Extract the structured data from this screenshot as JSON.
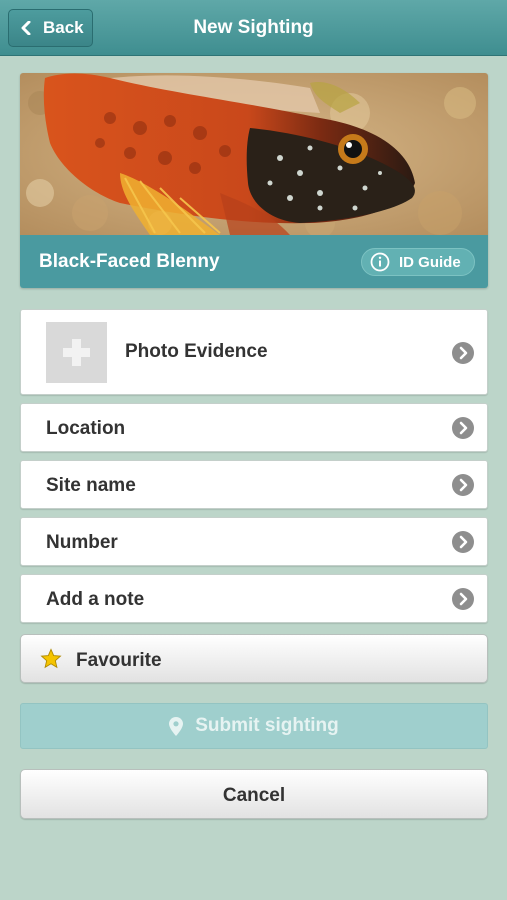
{
  "header": {
    "back_label": "Back",
    "title": "New Sighting"
  },
  "species": {
    "name": "Black-Faced Blenny",
    "id_guide_label": "ID Guide"
  },
  "rows": {
    "photo_evidence": "Photo Evidence",
    "location": "Location",
    "site_name": "Site name",
    "number": "Number",
    "note": "Add a note"
  },
  "favourite_label": "Favourite",
  "submit_label": "Submit sighting",
  "cancel_label": "Cancel",
  "colors": {
    "background": "#bcd5c9",
    "header": "#4a9aa0",
    "submit_disabled": "#9fcfcd",
    "star": "#f5c400"
  },
  "icons": [
    "chevron-left-icon",
    "info-icon",
    "plus-icon",
    "chevron-right-icon",
    "star-icon",
    "map-pin-icon"
  ]
}
